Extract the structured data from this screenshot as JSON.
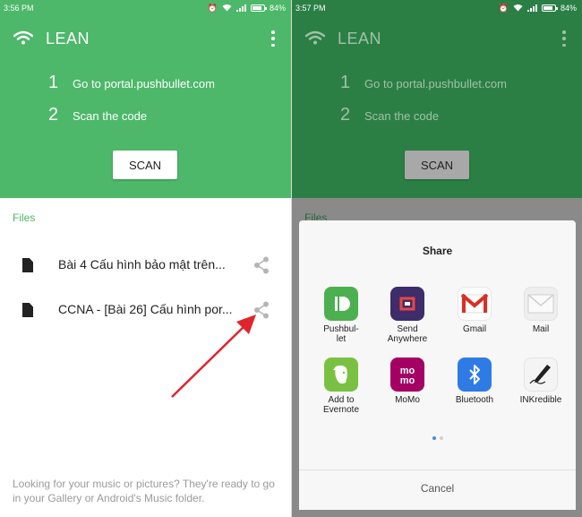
{
  "left": {
    "status": {
      "time": "3:56 PM",
      "battery": "84%"
    },
    "app_title": "LEAN",
    "steps": [
      {
        "num": "1",
        "text": "Go to portal.pushbullet.com"
      },
      {
        "num": "2",
        "text": "Scan the code"
      }
    ],
    "scan_label": "SCAN",
    "files_label": "Files",
    "files": [
      {
        "name": "Bài 4 Cấu hình bảo mật trên..."
      },
      {
        "name": "CCNA - [Bài 26] Cấu hình por..."
      }
    ],
    "footer": "Looking for your music or pictures? They're ready to go in your Gallery or Android's Music folder."
  },
  "right": {
    "status": {
      "time": "3:57 PM",
      "battery": "84%"
    },
    "app_title": "LEAN",
    "steps": [
      {
        "num": "1",
        "text": "Go to portal.pushbullet.com"
      },
      {
        "num": "2",
        "text": "Scan the code"
      }
    ],
    "scan_label": "SCAN",
    "files_label": "Files",
    "share": {
      "title": "Share",
      "apps": [
        {
          "label": "Pushbul-\nlet",
          "icon": "pushbullet-icon",
          "color": "#4cb050"
        },
        {
          "label": "Send\nAnywhere",
          "icon": "send-anywhere-icon",
          "color": "#3e2c6b"
        },
        {
          "label": "Gmail",
          "icon": "gmail-icon",
          "color": "#ffffff"
        },
        {
          "label": "Mail",
          "icon": "mail-icon",
          "color": "#eeeeee"
        },
        {
          "label": "Add to\nEvernote",
          "icon": "evernote-icon",
          "color": "#7ac143"
        },
        {
          "label": "MoMo",
          "icon": "momo-icon",
          "color": "#a50064"
        },
        {
          "label": "Bluetooth",
          "icon": "bluetooth-icon",
          "color": "#2f7be5"
        },
        {
          "label": "INKredible",
          "icon": "inkredible-icon",
          "color": "#f4f4f4"
        }
      ],
      "cancel_label": "Cancel"
    }
  },
  "colors": {
    "header_green": "#4db869",
    "header_green_dim": "#2b7f45",
    "files_green": "#4db869",
    "annotation_arrow": "#e0242b",
    "page_dot_active": "#3d8ee6",
    "page_dot_inactive": "#cfcfcf"
  }
}
